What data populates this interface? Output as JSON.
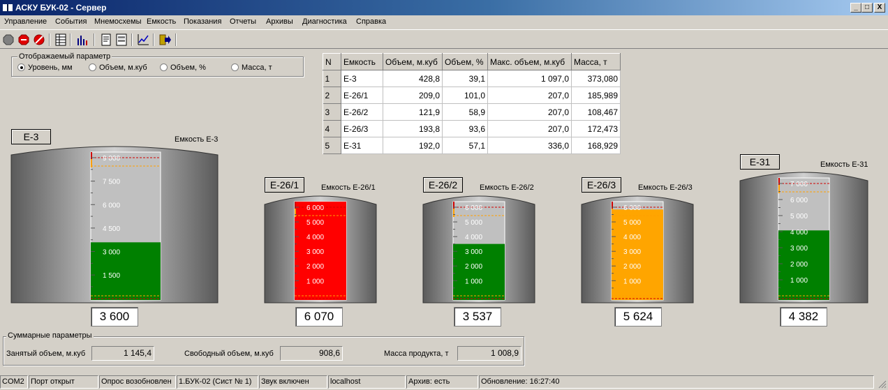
{
  "window": {
    "title": "АСКУ БУК-02 - Сервер",
    "buttons": [
      "_",
      "□",
      "X"
    ]
  },
  "menu": [
    "Управление",
    "События",
    "Мнемосхемы",
    "Емкость",
    "Показания",
    "Отчеты",
    "Архивы",
    "Диагностика",
    "Справка"
  ],
  "toolbar": {
    "icons": [
      "stop-gray-icon",
      "stop-red-icon",
      "no-entry-icon",
      "table-icon",
      "bar-chart-icon",
      "report-icon",
      "report-list-icon",
      "line-chart-icon",
      "exit-icon"
    ]
  },
  "param_group": {
    "legend": "Отображаемый параметр",
    "options": [
      "Уровень, мм",
      "Объем, м.куб",
      "Объем, %",
      "Масса, т"
    ],
    "selected": 0
  },
  "table": {
    "headers": [
      "N",
      "Емкость",
      "Объем, м.куб",
      "Объем, %",
      "Макс. объем, м.куб",
      "Масса, т"
    ],
    "rows": [
      [
        "1",
        "Е-3",
        "428,8",
        "39,1",
        "1 097,0",
        "373,080"
      ],
      [
        "2",
        "Е-26/1",
        "209,0",
        "101,0",
        "207,0",
        "185,989"
      ],
      [
        "3",
        "Е-26/2",
        "121,9",
        "58,9",
        "207,0",
        "108,467"
      ],
      [
        "4",
        "Е-26/3",
        "193,8",
        "93,6",
        "207,0",
        "172,473"
      ],
      [
        "5",
        "Е-31",
        "192,0",
        "57,1",
        "336,0",
        "168,929"
      ]
    ]
  },
  "tanks": [
    {
      "tag": "Е-3",
      "caption": "Емкость Е-3",
      "value": "3 600",
      "fill_level": 0.39,
      "fill_color": "#008000",
      "ticks": [
        "9 000",
        "7 500",
        "6 000",
        "4 500",
        "3 000",
        "1 500"
      ]
    },
    {
      "tag": "Е-26/1",
      "caption": "Емкость Е-26/1",
      "value": "6 070",
      "fill_level": 1.0,
      "fill_color": "#ff0000",
      "ticks": [
        "6 000",
        "5 000",
        "4 000",
        "3 000",
        "2 000",
        "1 000"
      ]
    },
    {
      "tag": "Е-26/2",
      "caption": "Емкость Е-26/2",
      "value": "3 537",
      "fill_level": 0.57,
      "fill_color": "#008000",
      "ticks": [
        "6 000",
        "5 000",
        "4 000",
        "3 000",
        "2 000",
        "1 000"
      ]
    },
    {
      "tag": "Е-26/3",
      "caption": "Емкость Е-26/3",
      "value": "5 624",
      "fill_level": 0.92,
      "fill_color": "#ffa500",
      "ticks": [
        "6 000",
        "5 000",
        "4 000",
        "3 000",
        "2 000",
        "1 000"
      ]
    },
    {
      "tag": "Е-31",
      "caption": "Емкость Е-31",
      "value": "4 382",
      "fill_level": 0.57,
      "fill_color": "#008000",
      "ticks": [
        "7 000",
        "6 000",
        "5 000",
        "4 000",
        "3 000",
        "2 000",
        "1 000"
      ]
    }
  ],
  "summary": {
    "legend": "Суммарные параметры",
    "occupied_label": "Занятый объем, м.куб",
    "occupied_value": "1 145,4",
    "free_label": "Свободный объем, м.куб",
    "free_value": "908,6",
    "mass_label": "Масса продукта, т",
    "mass_value": "1 008,9"
  },
  "status": [
    "COM2",
    "Порт открыт",
    "Опрос возобновлен",
    "1.БУК-02 (Сист № 1)",
    "Звук включен",
    "localhost",
    "Архив: есть",
    "Обновление: 16:27:40"
  ]
}
